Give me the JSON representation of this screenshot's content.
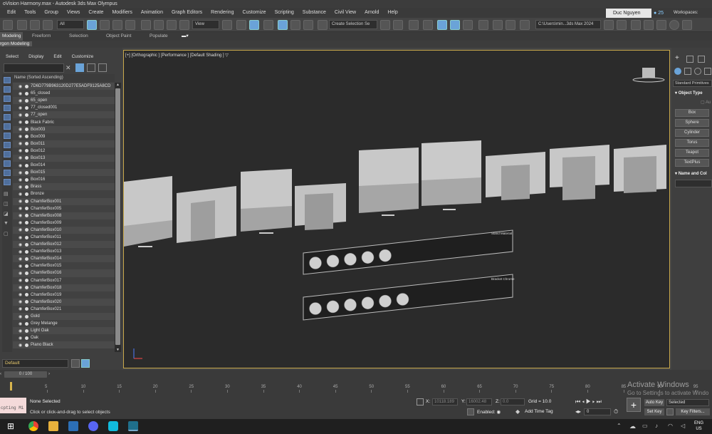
{
  "title_bar": {
    "title": "oVision Harmony.max - Autodesk 3ds Max Olympus"
  },
  "menu": [
    "Edit",
    "Tools",
    "Group",
    "Views",
    "Create",
    "Modifiers",
    "Animation",
    "Graph Editors",
    "Rendering",
    "Customize",
    "Scripting",
    "Substance",
    "Civil View",
    "Arnold",
    "Help"
  ],
  "user": {
    "name": "Duc Nguyen",
    "notifications": "25",
    "workspaces_label": "Workspaces:"
  },
  "toolbar": {
    "filter_dropdown": "All",
    "view_dropdown": "View",
    "selection_set_dropdown": "Create Selection Se",
    "project_path": "C:\\Users\\min...3ds Max 2024"
  },
  "ribbon": {
    "tabs": [
      "Modeling",
      "Freeform",
      "Selection",
      "Object Paint",
      "Populate"
    ],
    "active_tab": "Modeling",
    "sub_label": "rgon Modeling"
  },
  "scene_explorer": {
    "tabs": [
      "Select",
      "Display",
      "Edit",
      "Customize"
    ],
    "column_header": "Name (Sorted Ascending)",
    "items": [
      "7D6D779B963120D277E5ADF9125A8CD",
      "65_closed",
      "65_open",
      "77_closed001",
      "77_open",
      "Black Fabric",
      "Box003",
      "Box009",
      "Box011",
      "Box012",
      "Box013",
      "Box014",
      "Box015",
      "Box016",
      "Brass",
      "Bronze",
      "ChamferBox001",
      "ChamferBox005",
      "ChamferBox008",
      "ChamferBox009",
      "ChamferBox010",
      "ChamferBox011",
      "ChamferBox012",
      "ChamferBox013",
      "ChamferBox014",
      "ChamferBox015",
      "ChamferBox016",
      "ChamferBox017",
      "ChamferBox018",
      "ChamferBox019",
      "ChamferBox020",
      "ChamferBox021",
      "Gold",
      "Grey Melange",
      "Light Oak",
      "Oak",
      "Piano Black"
    ],
    "layer": "Default"
  },
  "viewport": {
    "label": "[+] [Orthographic ] [Performance ] [Default Shading ]",
    "panel_labels": [
      "Stand Material",
      "Bracket Chrome"
    ]
  },
  "command_panel": {
    "category_dropdown": "Standard Primitives",
    "object_type_title": "Object Type",
    "autogrid": "Au",
    "buttons": [
      "Box",
      "Sphere",
      "Cylinder",
      "Torus",
      "Teapot",
      "TextPlus"
    ],
    "name_color_title": "Name and Col"
  },
  "timeline": {
    "frame_display": "0 / 100",
    "ticks": [
      "5",
      "10",
      "15",
      "20",
      "25",
      "30",
      "35",
      "40",
      "45",
      "50",
      "55",
      "60",
      "65",
      "70",
      "75",
      "80",
      "85",
      "90",
      "95"
    ]
  },
  "status": {
    "maxscript_text": "cpting Mi",
    "selection": "None Selected",
    "prompt": "Click or click-and-drag to select objects",
    "x_label": "X:",
    "x_value": "10118.189",
    "y_label": "Y:",
    "y_value": "16002.48",
    "z_label": "Z:",
    "z_value": "0.0",
    "grid": "Grid = 10.0",
    "enabled_label": "Enabled:",
    "add_time_tag": "Add Time Tag",
    "frame_field": "0",
    "auto_key": "Auto Key",
    "set_key": "Set Key",
    "selected_dropdown": "Selected",
    "key_filters": "Key Filters..."
  },
  "watermark": {
    "line1": "Activate Windows",
    "line2": "Go to Settings to activate Windo"
  },
  "taskbar": {
    "lang1": "ENG",
    "lang2": "US"
  },
  "colors": {
    "viewport_bg": "#2b2b2b",
    "viewport_border": "#c8a84a",
    "accent": "#6aa3d8"
  }
}
